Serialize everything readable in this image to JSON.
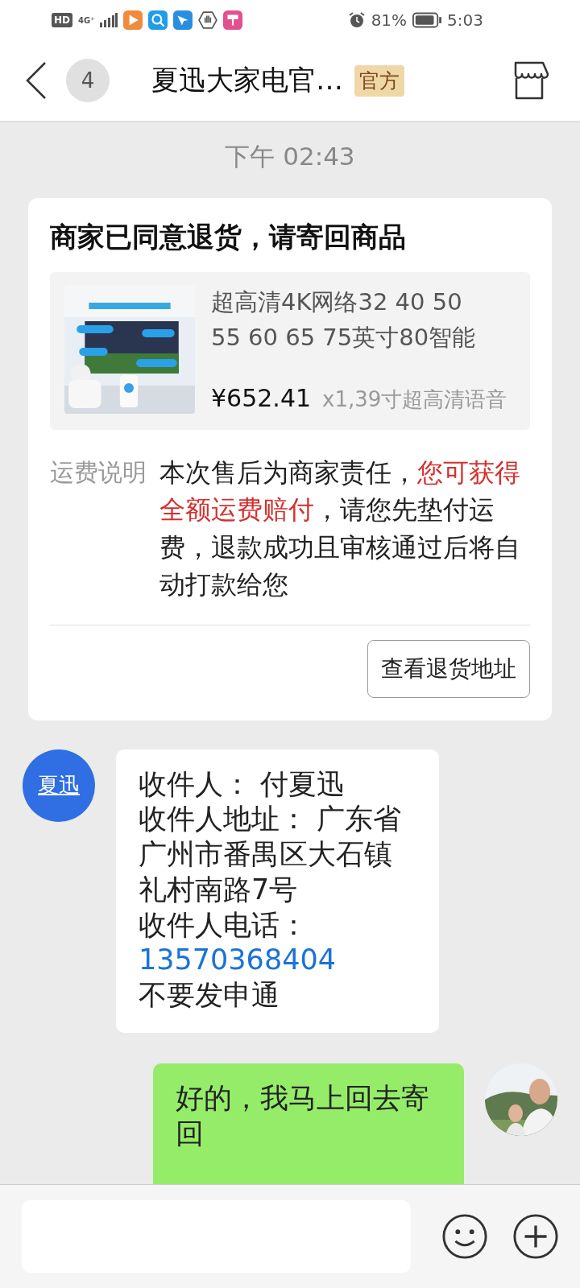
{
  "status_bar": {
    "hd": "HD",
    "battery": "81%",
    "time": "5:03",
    "network": "4G⁺"
  },
  "header": {
    "back_count": "4",
    "title": "夏迅大家电官…",
    "badge": "官方"
  },
  "chat": {
    "timestamp": "下午 02:43",
    "return_card": {
      "title": "商家已同意退货，请寄回商品",
      "product": {
        "name": "超高清4K网络32 40 50 55 60 65 75英寸80智能",
        "price": "¥652.41",
        "spec": "x1,39寸超高清语音"
      },
      "fee_label": "运费说明",
      "fee_text": [
        {
          "text": "本次售后为商家责任，",
          "highlight": false
        },
        {
          "text": "您可获得全额运费赔付",
          "highlight": true
        },
        {
          "text": "，请您先垫付运费，退款成功且审核通过后将自动打款给您",
          "highlight": false
        }
      ],
      "button": "查看退货地址"
    },
    "messages": [
      {
        "kind": "incoming",
        "avatar": "夏迅",
        "lines": [
          {
            "text": "收件人：  付夏迅",
            "link": false
          },
          {
            "text": "收件人地址：  广东省广州市番禺区大石镇礼村南路7号",
            "link": false
          },
          {
            "text": "收件人电话：",
            "link": false
          },
          {
            "text": "13570368404",
            "link": true
          },
          {
            "text": "不要发申通",
            "link": false
          }
        ]
      },
      {
        "kind": "outgoing",
        "lines": [
          {
            "text": "好的，我马上回去寄回",
            "link": false
          }
        ]
      }
    ]
  }
}
